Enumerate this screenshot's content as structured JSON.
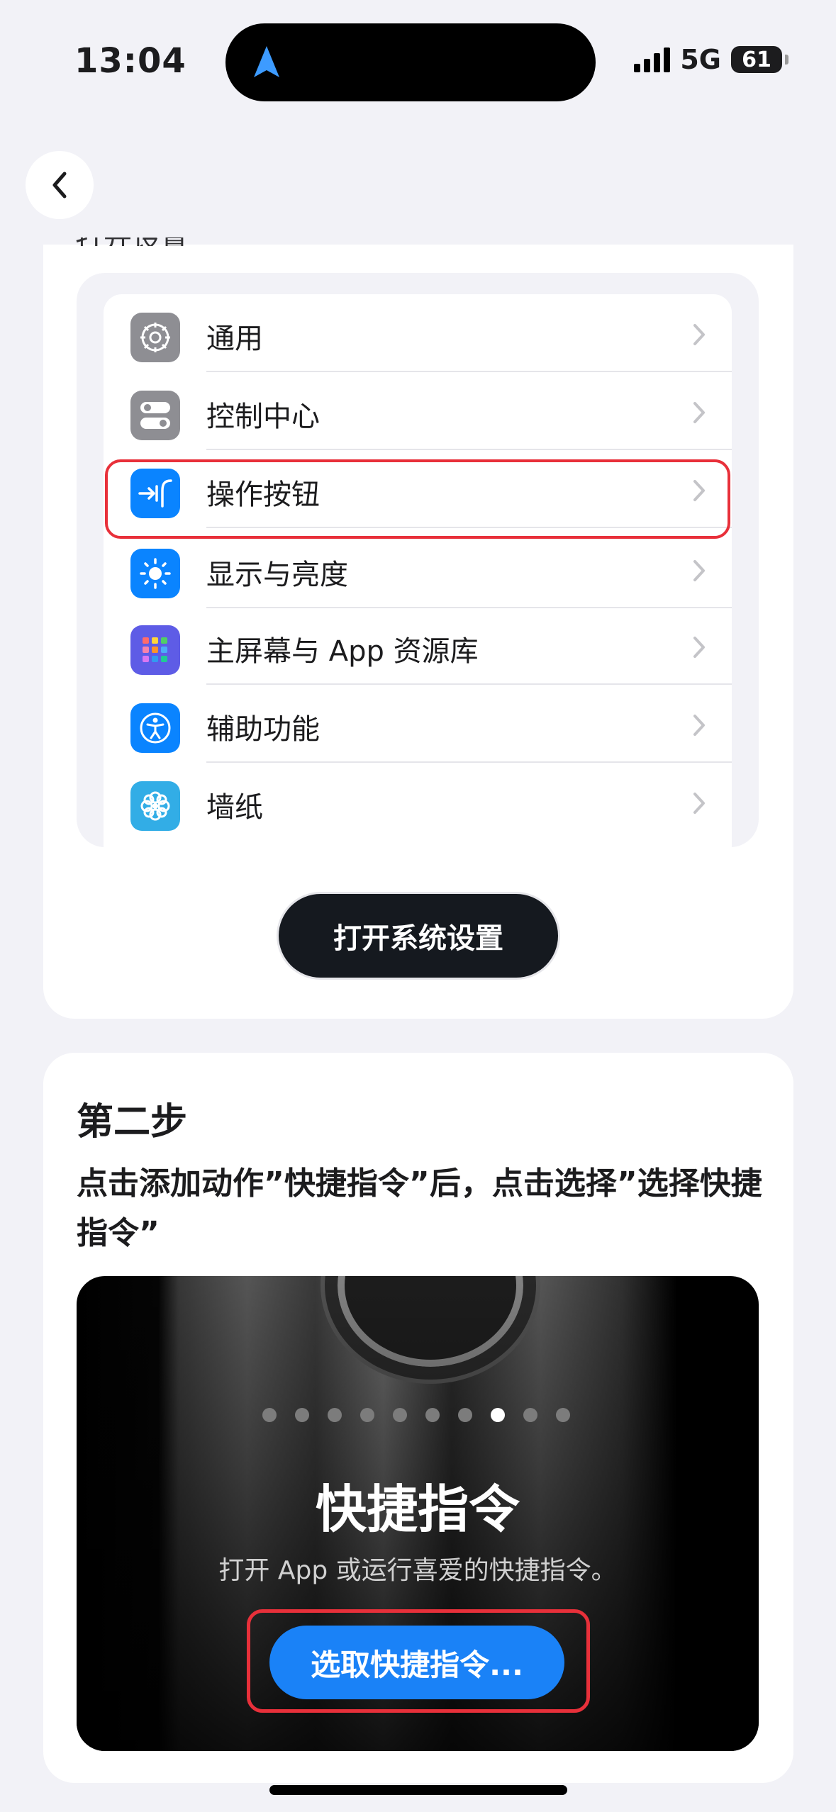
{
  "status_bar": {
    "time": "13:04",
    "network": "5G",
    "battery": "61"
  },
  "header": {
    "back_icon": "chevron-left-icon"
  },
  "step1": {
    "clipped_heading": "打开设置",
    "settings_items": [
      {
        "label": "通用",
        "icon": "gear-icon",
        "color": "#8e8e93"
      },
      {
        "label": "控制中心",
        "icon": "toggles-icon",
        "color": "#8e8e93"
      },
      {
        "label": "操作按钮",
        "icon": "action-button-icon",
        "color": "#0a84ff"
      },
      {
        "label": "显示与亮度",
        "icon": "sun-icon",
        "color": "#0a84ff"
      },
      {
        "label": "主屏幕与 App 资源库",
        "icon": "app-grid-icon",
        "color": "#5e5ce6"
      },
      {
        "label": "辅助功能",
        "icon": "accessibility-icon",
        "color": "#0a84ff"
      },
      {
        "label": "墙纸",
        "icon": "flower-icon",
        "color": "#32ade6"
      }
    ],
    "open_button": "打开系统设置"
  },
  "step2": {
    "title": "第二步",
    "description": "点击添加动作”快捷指令”后，点击选择”选择快捷指令”",
    "demo": {
      "title": "快捷指令",
      "subtitle": "打开 App 或运行喜爱的快捷指令。",
      "button": "选取快捷指令...",
      "page_count": 10,
      "active_page": 8
    }
  },
  "colors": {
    "highlight": "#e8303a",
    "accent_blue": "#1a82f7",
    "dark_button": "#15191f"
  }
}
